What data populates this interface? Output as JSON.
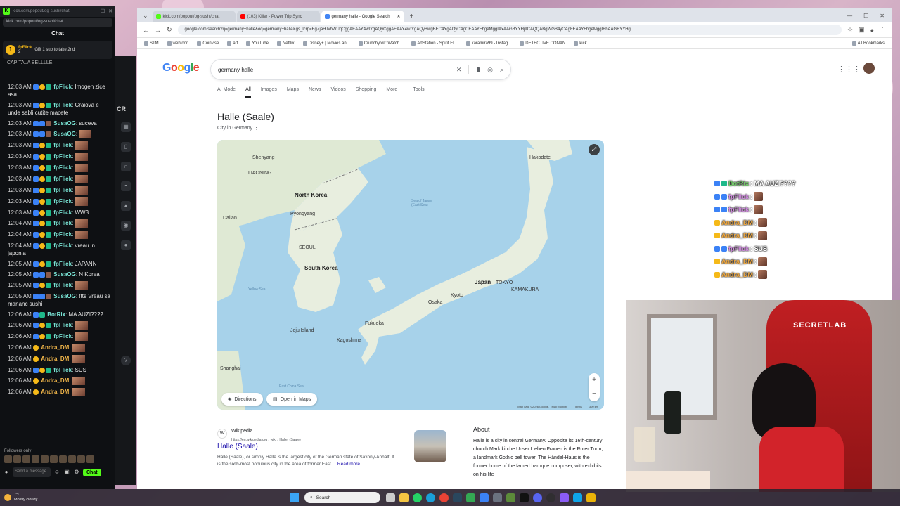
{
  "chat_window": {
    "url": "kick.com/popout/og-sushi/chat",
    "header": "Chat",
    "gift_user": "fpFlick",
    "gift_amount": "2",
    "gift_text": "Gift 1 sub to take 2nd",
    "pinned_ghost": "CAPITALA BELLLLE",
    "messages": [
      {
        "time": "12:03 AM",
        "user": "fpFlick",
        "text": ": Imogen zice asa",
        "type": "fp",
        "wrap": true
      },
      {
        "time": "12:03 AM",
        "user": "fpFlick",
        "text": ": Craiova e unde sabli cutite macete",
        "type": "fp",
        "wrap": true
      },
      {
        "time": "12:03 AM",
        "user": "SusaOG",
        "text": ": suceva",
        "type": "su",
        "wrap": false
      },
      {
        "time": "12:03 AM",
        "user": "SusaOG",
        "text": ":",
        "type": "su",
        "emote": true,
        "wrap": false
      },
      {
        "time": "12:03 AM",
        "user": "fpFlick",
        "text": ":",
        "type": "fp",
        "emote": true,
        "wrap": false
      },
      {
        "time": "12:03 AM",
        "user": "fpFlick",
        "text": ":",
        "type": "fp",
        "emote": true,
        "wrap": false
      },
      {
        "time": "12:03 AM",
        "user": "fpFlick",
        "text": ":",
        "type": "fp",
        "emote": true,
        "wrap": false
      },
      {
        "time": "12:03 AM",
        "user": "fpFlick",
        "text": ":",
        "type": "fp",
        "emote": true,
        "wrap": false
      },
      {
        "time": "12:03 AM",
        "user": "fpFlick",
        "text": ":",
        "type": "fp",
        "emote": true,
        "wrap": false
      },
      {
        "time": "12:03 AM",
        "user": "fpFlick",
        "text": ":",
        "type": "fp",
        "emote": true,
        "wrap": false
      },
      {
        "time": "12:03 AM",
        "user": "fpFlick",
        "text": ": WW3",
        "type": "fp",
        "wrap": false
      },
      {
        "time": "12:04 AM",
        "user": "fpFlick",
        "text": ":",
        "type": "fp",
        "emote": true,
        "wrap": false
      },
      {
        "time": "12:04 AM",
        "user": "fpFlick",
        "text": ":",
        "type": "fp",
        "emote": true,
        "wrap": false
      },
      {
        "time": "12:04 AM",
        "user": "fpFlick",
        "text": ": vreau in japonia",
        "type": "fp",
        "wrap": true
      },
      {
        "time": "12:05 AM",
        "user": "fpFlick",
        "text": ": JAPANN",
        "type": "fp",
        "wrap": false
      },
      {
        "time": "12:05 AM",
        "user": "SusaOG",
        "text": ": N Korea",
        "type": "su",
        "wrap": false
      },
      {
        "time": "12:05 AM",
        "user": "fpFlick",
        "text": ":",
        "type": "fp",
        "emote": true,
        "wrap": false
      },
      {
        "time": "12:05 AM",
        "user": "SusaOG",
        "text": ": !tts Vreau sa mananc sushi",
        "type": "su",
        "wrap": true
      },
      {
        "time": "12:06 AM",
        "user": "BotRix",
        "text": ": MA AUZI????",
        "type": "bot",
        "wrap": true
      },
      {
        "time": "12:06 AM",
        "user": "fpFlick",
        "text": ":",
        "type": "fp",
        "emote": true,
        "wrap": false
      },
      {
        "time": "12:06 AM",
        "user": "fpFlick",
        "text": ":",
        "type": "fp",
        "emote": true,
        "wrap": false
      },
      {
        "time": "12:06 AM",
        "user": "Andra_DM",
        "text": ":",
        "type": "an",
        "emote": true,
        "wrap": false
      },
      {
        "time": "12:06 AM",
        "user": "Andra_DM",
        "text": ":",
        "type": "an",
        "emote": true,
        "wrap": false
      },
      {
        "time": "12:06 AM",
        "user": "fpFlick",
        "text": ": SUS",
        "type": "fp",
        "wrap": false
      },
      {
        "time": "12:06 AM",
        "user": "Andra_DM",
        "text": ":",
        "type": "an",
        "emote": true,
        "wrap": false
      },
      {
        "time": "12:06 AM",
        "user": "Andra_DM",
        "text": ":",
        "type": "an",
        "emote": true,
        "wrap": false
      }
    ],
    "followers_only": "Followers only",
    "input_placeholder": "Send a message",
    "send_label": "Chat"
  },
  "kick_strip": {
    "label": "CR"
  },
  "browser": {
    "tabs": [
      {
        "label": "kick.com/popout/og-sushi/chat",
        "color": "#53fc18"
      },
      {
        "label": "(103) Killer - Power Trip Sync",
        "color": "#ff0000"
      },
      {
        "label": "germany halle - Google Search",
        "color": "#4285f4",
        "active": true
      }
    ],
    "address": "google.com/search?q=germany+halle&oq=germany+halle&gs_lcrp=EgZjaHJvbWUqCggAEAAY4wIYgAQyCggAEAAY4wIYgAQyBwgBEC4YgAQyCAgCEAAYFhgeMggIAxAAGBYYHjIICAQQABgWGB4yCAgFEAAYFhgeMggIBhAAGBYYHg",
    "bookmarks": [
      "STM",
      "webtoon",
      "Coinvise",
      "art",
      "YouTube",
      "Netflix",
      "Disney+ | Movies an...",
      "Crunchyroll: Watch...",
      "ArtStation - Spirit El...",
      "karamira99 - Instag...",
      "DETECTIVE CONAN",
      "kick",
      "All Bookmarks"
    ]
  },
  "google": {
    "query": "germany halle",
    "tabs": [
      "AI Mode",
      "All",
      "Images",
      "Maps",
      "News",
      "Videos",
      "Shopping",
      "More",
      "Tools"
    ],
    "active_tab": "All",
    "kp_title": "Halle (Saale)",
    "kp_subtitle": "City in Germany",
    "map": {
      "labels": {
        "north_korea": "North Korea",
        "south_korea": "South Korea",
        "japan": "Japan",
        "shenyang": "Shenyang",
        "liaoning": "LIAONING",
        "dalian": "Dalian",
        "pyongyang": "Pyongyang",
        "seoul": "SEOUL",
        "tokyo": "TOKYO",
        "osaka": "Osaka",
        "kyoto": "Kyoto",
        "fukuoka": "Fukuoka",
        "kagoshima": "Kagoshima",
        "kamakura": "KAMAKURA",
        "hakodate": "Hakodate",
        "jeju": "Jeju Island",
        "shanghai": "Shanghai",
        "sea_of_japan": "Sea of Japan (East Sea)",
        "yellow_sea": "Yellow Sea",
        "east_china_sea": "East China Sea"
      },
      "directions_label": "Directions",
      "open_maps_label": "Open in Maps",
      "credits": "Map data ©2026 Google, TMap Mobility",
      "terms": "Terms",
      "scale": "300 km"
    },
    "wiki": {
      "source": "Wikipedia",
      "url": "https://en.wikipedia.org › wiki › Halle_(Saale)",
      "title": "Halle (Saale)",
      "snippet": "Halle (Saale), or simply Halle is the largest city of the German state of Saxony-Anhalt. It is the sixth-most populous city in the area of former East ...",
      "read_more": "Read more"
    },
    "about": {
      "heading": "About",
      "text": "Halle is a city in central Germany. Opposite its 16th-century church Marktkirche Unser Lieben Frauen is the Roter Turm, a landmark Gothic bell tower. The Händel-Haus is the former home of the famed baroque composer, with exhibits on his life"
    }
  },
  "overlay_chat": [
    {
      "user": "BotRix",
      "text": ": MA AUZI????",
      "type": "bot"
    },
    {
      "user": "fpFlick",
      "text": ":",
      "type": "fp",
      "emote": true
    },
    {
      "user": "fpFlick",
      "text": ":",
      "type": "fp",
      "emote": true
    },
    {
      "user": "Andra_DM",
      "text": ":",
      "type": "an",
      "emote": true
    },
    {
      "user": "Andra_DM",
      "text": ":",
      "type": "an",
      "emote": true
    },
    {
      "user": "fpFlick",
      "text": ": SUS",
      "type": "fp"
    },
    {
      "user": "Andra_DM",
      "text": ":",
      "type": "an",
      "emote": true
    },
    {
      "user": "Andra_DM",
      "text": ":",
      "type": "an",
      "emote": true
    }
  ],
  "webcam": {
    "chair_logo": "SECRETLAB"
  },
  "taskbar": {
    "temp": "7°C",
    "weather": "Mostly cloudy",
    "search": "Search"
  }
}
